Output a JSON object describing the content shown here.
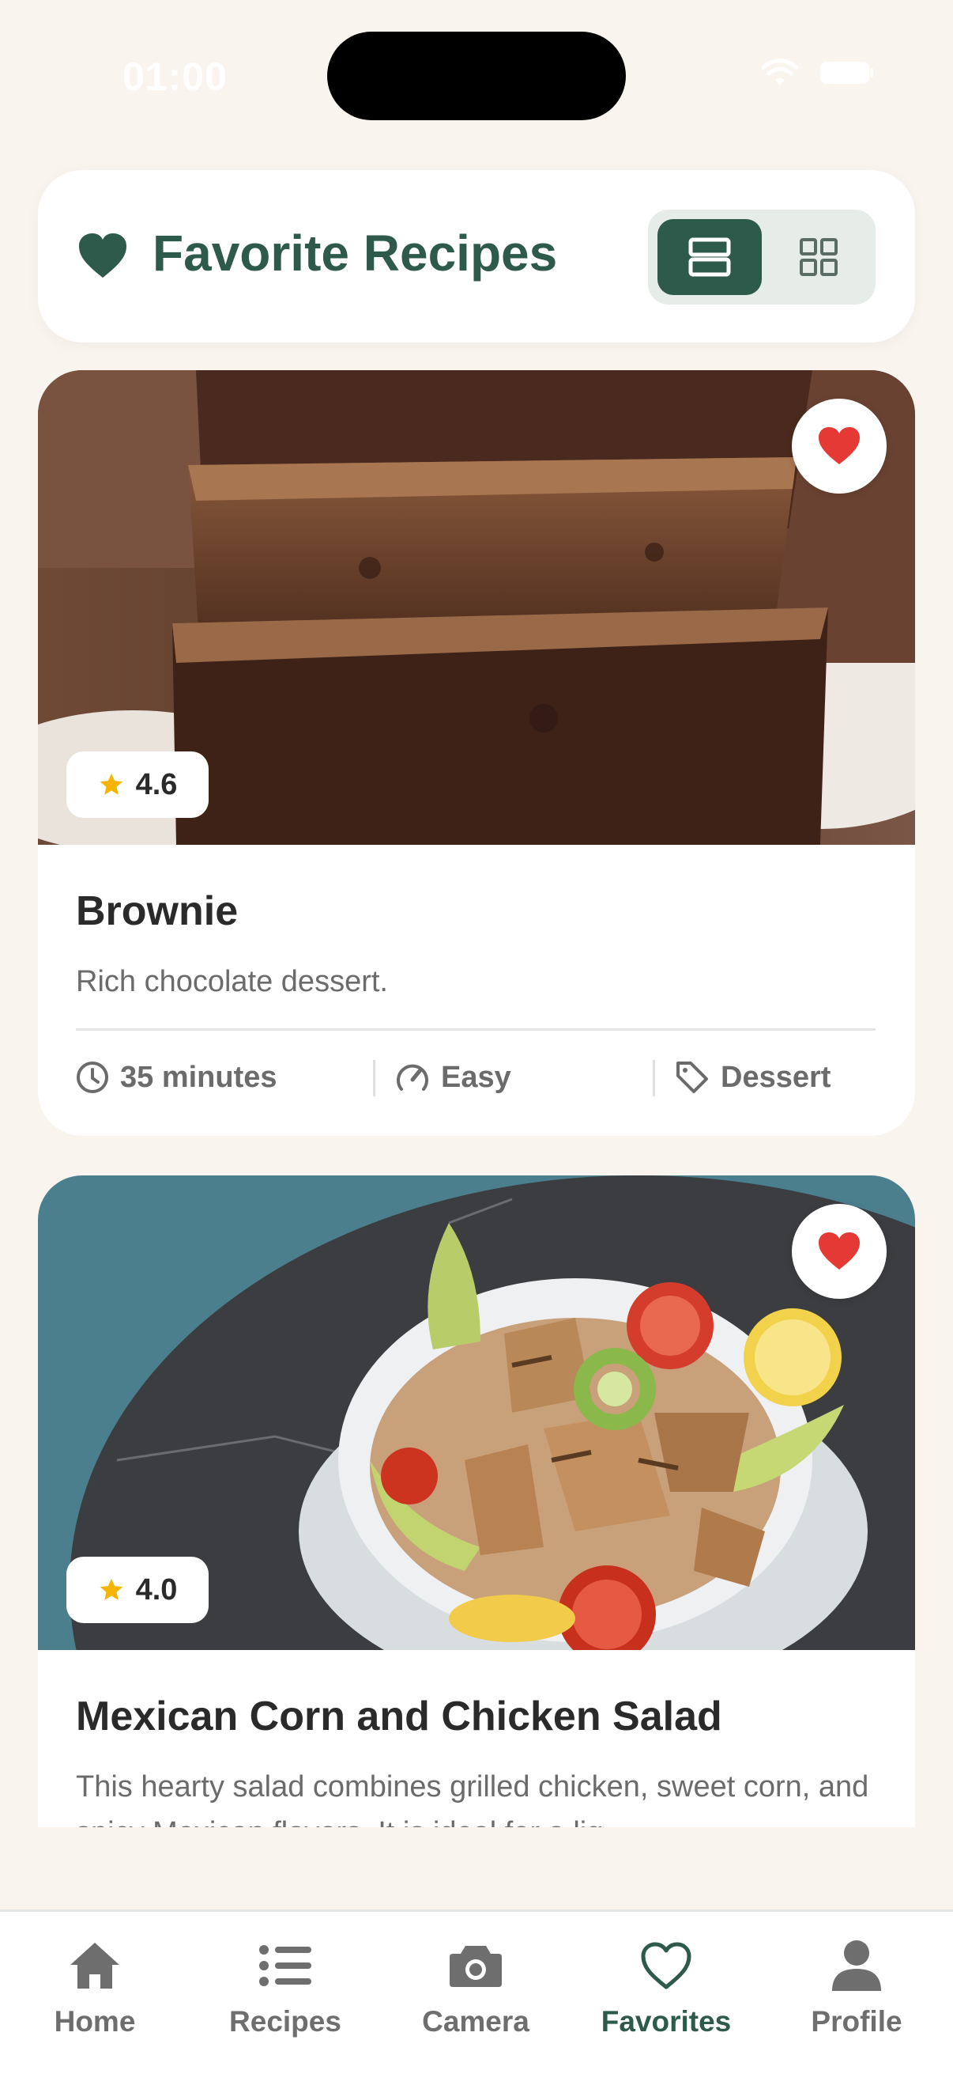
{
  "status_bar": {
    "time": "01:00"
  },
  "header": {
    "title": "Favorite Recipes"
  },
  "recipes": [
    {
      "title": "Brownie",
      "description": "Rich chocolate dessert.",
      "rating": "4.6",
      "time": "35 minutes",
      "difficulty": "Easy",
      "category": "Dessert"
    },
    {
      "title": "Mexican Corn and Chicken Salad",
      "description": "This hearty salad combines grilled chicken, sweet corn, and spicy Mexican flavors. It is ideal for a lig",
      "rating": "4.0"
    }
  ],
  "nav": {
    "items": [
      {
        "label": "Home",
        "icon": "home-icon"
      },
      {
        "label": "Recipes",
        "icon": "list-icon"
      },
      {
        "label": "Camera",
        "icon": "camera-icon"
      },
      {
        "label": "Favorites",
        "icon": "heart-icon"
      },
      {
        "label": "Profile",
        "icon": "person-icon"
      }
    ],
    "active": "Favorites"
  },
  "colors": {
    "background": "#faf4ee",
    "brand_green": "#2d5a4a",
    "favorite_red": "#e53935",
    "star_yellow": "#f5b400"
  }
}
